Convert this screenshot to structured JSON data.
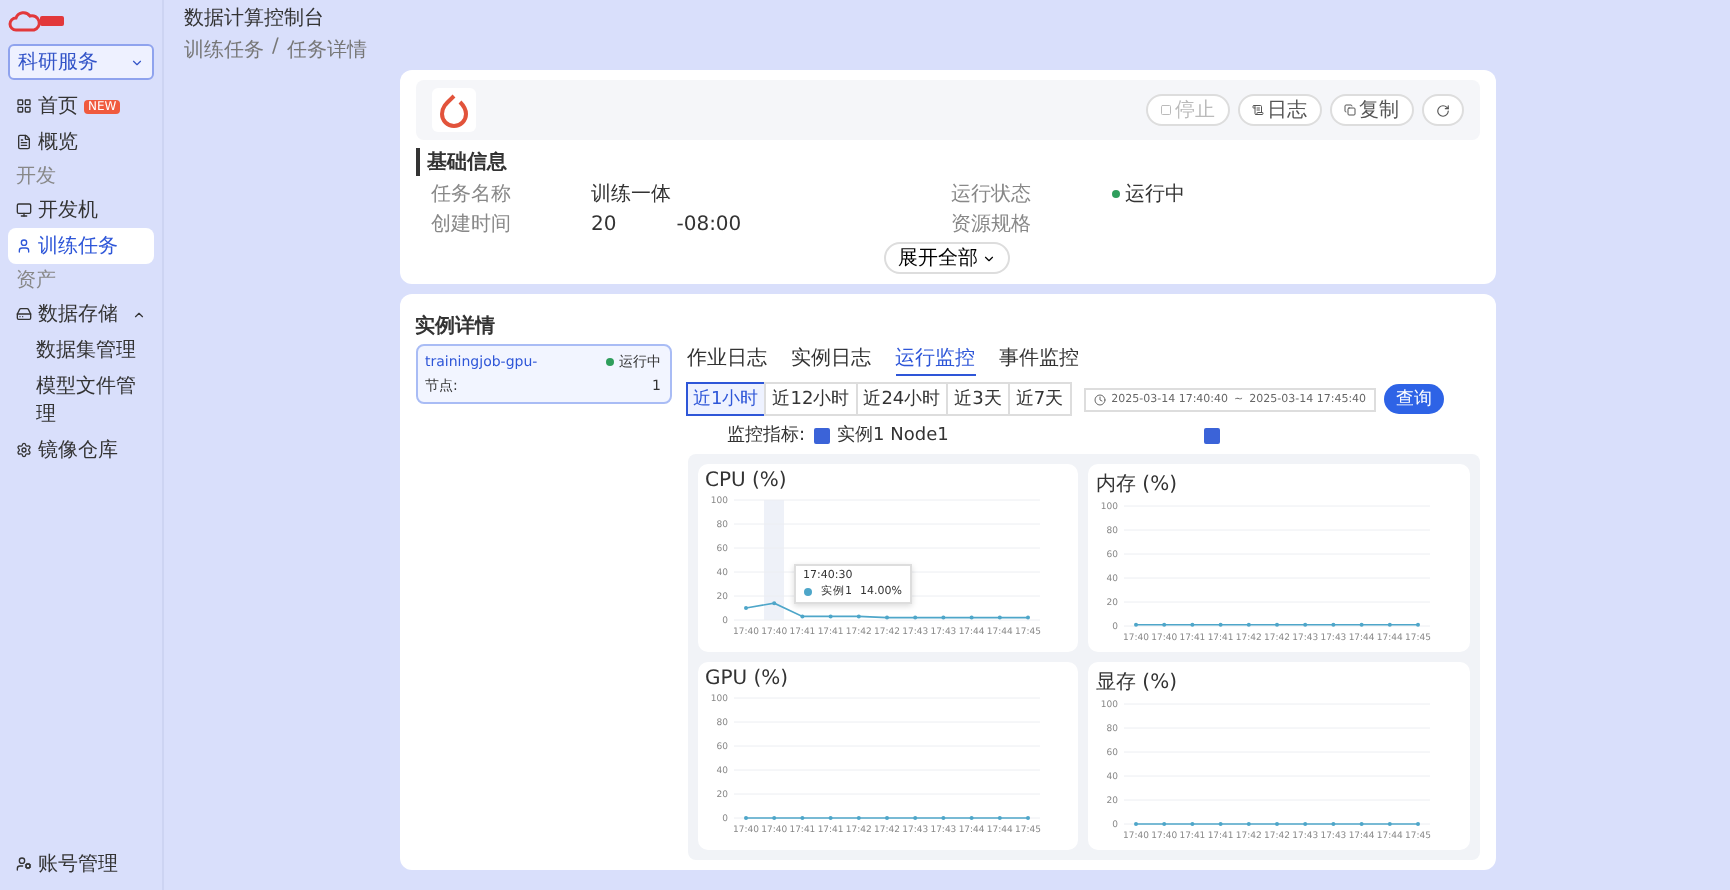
{
  "header": {
    "title": "数据计算控制台"
  },
  "breadcrumb": {
    "items": [
      "训练任务",
      "任务详情"
    ],
    "separator": "/"
  },
  "sidebar": {
    "workspace": "科研服务",
    "items": [
      {
        "kind": "item",
        "label": "首页",
        "badge": "NEW",
        "selected": false
      },
      {
        "kind": "item",
        "label": "概览",
        "selected": false
      },
      {
        "kind": "section",
        "label": "开发"
      },
      {
        "kind": "item",
        "label": "开发机",
        "selected": false
      },
      {
        "kind": "item",
        "label": "训练任务",
        "selected": true
      },
      {
        "kind": "section",
        "label": "资产"
      },
      {
        "kind": "item",
        "label": "数据存储",
        "selected": false,
        "expanded": true,
        "children": [
          {
            "label": "数据集管理",
            "selected": false
          },
          {
            "label": "模型文件管理",
            "selected": false
          }
        ]
      },
      {
        "kind": "item",
        "label": "镜像仓库",
        "selected": false
      }
    ],
    "footer_item": "账号管理"
  },
  "task": {
    "actions": [
      {
        "label": "停止",
        "disabled": true
      },
      {
        "label": "日志",
        "disabled": false
      },
      {
        "label": "复制",
        "disabled": false
      }
    ],
    "basic_info": {
      "title": "基础信息",
      "fields": [
        {
          "label": "任务名称",
          "value": "训练一体"
        },
        {
          "label": "运行状态",
          "value": "运行中",
          "kind": "status"
        },
        {
          "label": "创建时间",
          "value": "20",
          "value_2": "-08:00"
        },
        {
          "label": "资源规格"
        }
      ]
    },
    "expand_button": "展开全部"
  },
  "instance_details": {
    "title": "实例详情",
    "instances": [
      {
        "name": "trainingjob-gpu-",
        "status": "运行中",
        "node_label": "节点:",
        "node": "1",
        "selected": true
      }
    ],
    "tabs": [
      {
        "label": "作业日志",
        "selected": false
      },
      {
        "label": "实例日志",
        "selected": false
      },
      {
        "label": "运行监控",
        "selected": true
      },
      {
        "label": "事件监控",
        "selected": false
      }
    ],
    "ranges": [
      {
        "label": "近1小时",
        "selected": true
      },
      {
        "label": "近12小时",
        "selected": false
      },
      {
        "label": "近24小时",
        "selected": false
      },
      {
        "label": "近3天",
        "selected": false
      },
      {
        "label": "近7天",
        "selected": false
      }
    ],
    "date_range": {
      "start": "2025-03-14 17:40:40",
      "separator": "~",
      "end": "2025-03-14 17:45:40"
    },
    "query_button": "查询",
    "metric_filter": {
      "label": "监控指标:",
      "option": "实例1 Node1",
      "checked": true,
      "extra_checked": true
    },
    "charts": [
      {
        "tooltip": {
          "title": "17:40:30",
          "series": "实例1",
          "value": "14.00%"
        },
        "chart_data": {
          "type": "line",
          "title": "CPU (%)",
          "categories": [
            "17:40",
            "17:40",
            "17:41",
            "17:41",
            "17:42",
            "17:42",
            "17:43",
            "17:43",
            "17:44",
            "17:44",
            "17:45"
          ],
          "ylim": [
            0,
            100
          ],
          "yticks": [
            0,
            20,
            40,
            60,
            80,
            100
          ],
          "grid": true,
          "series": [
            {
              "color": "#4ea6c9",
              "values": [
                10,
                14,
                3,
                3,
                3,
                2,
                2,
                2,
                2,
                2,
                2
              ]
            }
          ]
        }
      },
      {
        "chart_data": {
          "type": "line",
          "title": "内存 (%)",
          "categories": [
            "17:40",
            "17:40",
            "17:41",
            "17:41",
            "17:42",
            "17:42",
            "17:43",
            "17:43",
            "17:44",
            "17:44",
            "17:45"
          ],
          "ylim": [
            0,
            100
          ],
          "yticks": [
            0,
            20,
            40,
            60,
            80,
            100
          ],
          "grid": true,
          "series": [
            {
              "color": "#4ea6c9",
              "values": [
                1,
                1,
                1,
                1,
                1,
                1,
                1,
                1,
                1,
                1,
                1
              ]
            }
          ]
        }
      },
      {
        "chart_data": {
          "type": "line",
          "title": "GPU (%)",
          "categories": [
            "17:40",
            "17:40",
            "17:41",
            "17:41",
            "17:42",
            "17:42",
            "17:43",
            "17:43",
            "17:44",
            "17:44",
            "17:45"
          ],
          "ylim": [
            0,
            100
          ],
          "yticks": [
            0,
            20,
            40,
            60,
            80,
            100
          ],
          "grid": true,
          "series": [
            {
              "color": "#4ea6c9",
              "values": [
                0,
                0,
                0,
                0,
                0,
                0,
                0,
                0,
                0,
                0,
                0
              ]
            }
          ]
        }
      },
      {
        "chart_data": {
          "type": "line",
          "title": "显存 (%)",
          "categories": [
            "17:40",
            "17:40",
            "17:41",
            "17:41",
            "17:42",
            "17:42",
            "17:43",
            "17:43",
            "17:44",
            "17:44",
            "17:45"
          ],
          "ylim": [
            0,
            100
          ],
          "yticks": [
            0,
            20,
            40,
            60,
            80,
            100
          ],
          "grid": true,
          "series": [
            {
              "color": "#4ea6c9",
              "values": [
                0,
                0,
                0,
                0,
                0,
                0,
                0,
                0,
                0,
                0,
                0
              ]
            }
          ]
        }
      }
    ]
  }
}
